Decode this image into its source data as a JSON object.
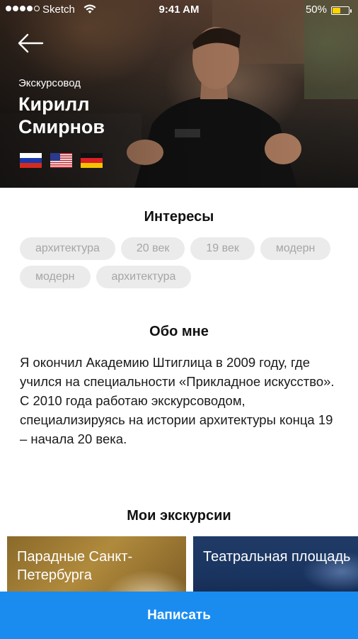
{
  "status_bar": {
    "carrier": "Sketch",
    "time": "9:41 AM",
    "battery": "50%",
    "battery_level": 0.5
  },
  "header": {
    "back_icon": "arrow-left-icon",
    "role": "Экскурсовод",
    "name_first": "Кирилл",
    "name_last": "Смирнов",
    "languages": [
      "russia-flag-icon",
      "usa-flag-icon",
      "germany-flag-icon"
    ]
  },
  "interests": {
    "title": "Интересы",
    "chips": [
      "архитектура",
      "20 век",
      "19 век",
      "модерн",
      "модерн",
      "архитектура"
    ]
  },
  "about": {
    "title": "Обо мне",
    "text": "Я окончил Академию Штиглица в 2009 году, где учился на специальности «Прикладное искусство». С 2010 года работаю экскурсоводом, специализируясь на истории архитектуры конца 19 – начала 20 века."
  },
  "tours": {
    "title": "Мои экскурсии",
    "items": [
      {
        "title": "Парадные Санкт-Петербурга"
      },
      {
        "title": "Театральная площадь"
      }
    ]
  },
  "actions": {
    "write_label": "Написать"
  },
  "colors": {
    "accent": "#1a8cf0",
    "chip_bg": "#ebebeb",
    "chip_text": "#a5a5a5"
  }
}
